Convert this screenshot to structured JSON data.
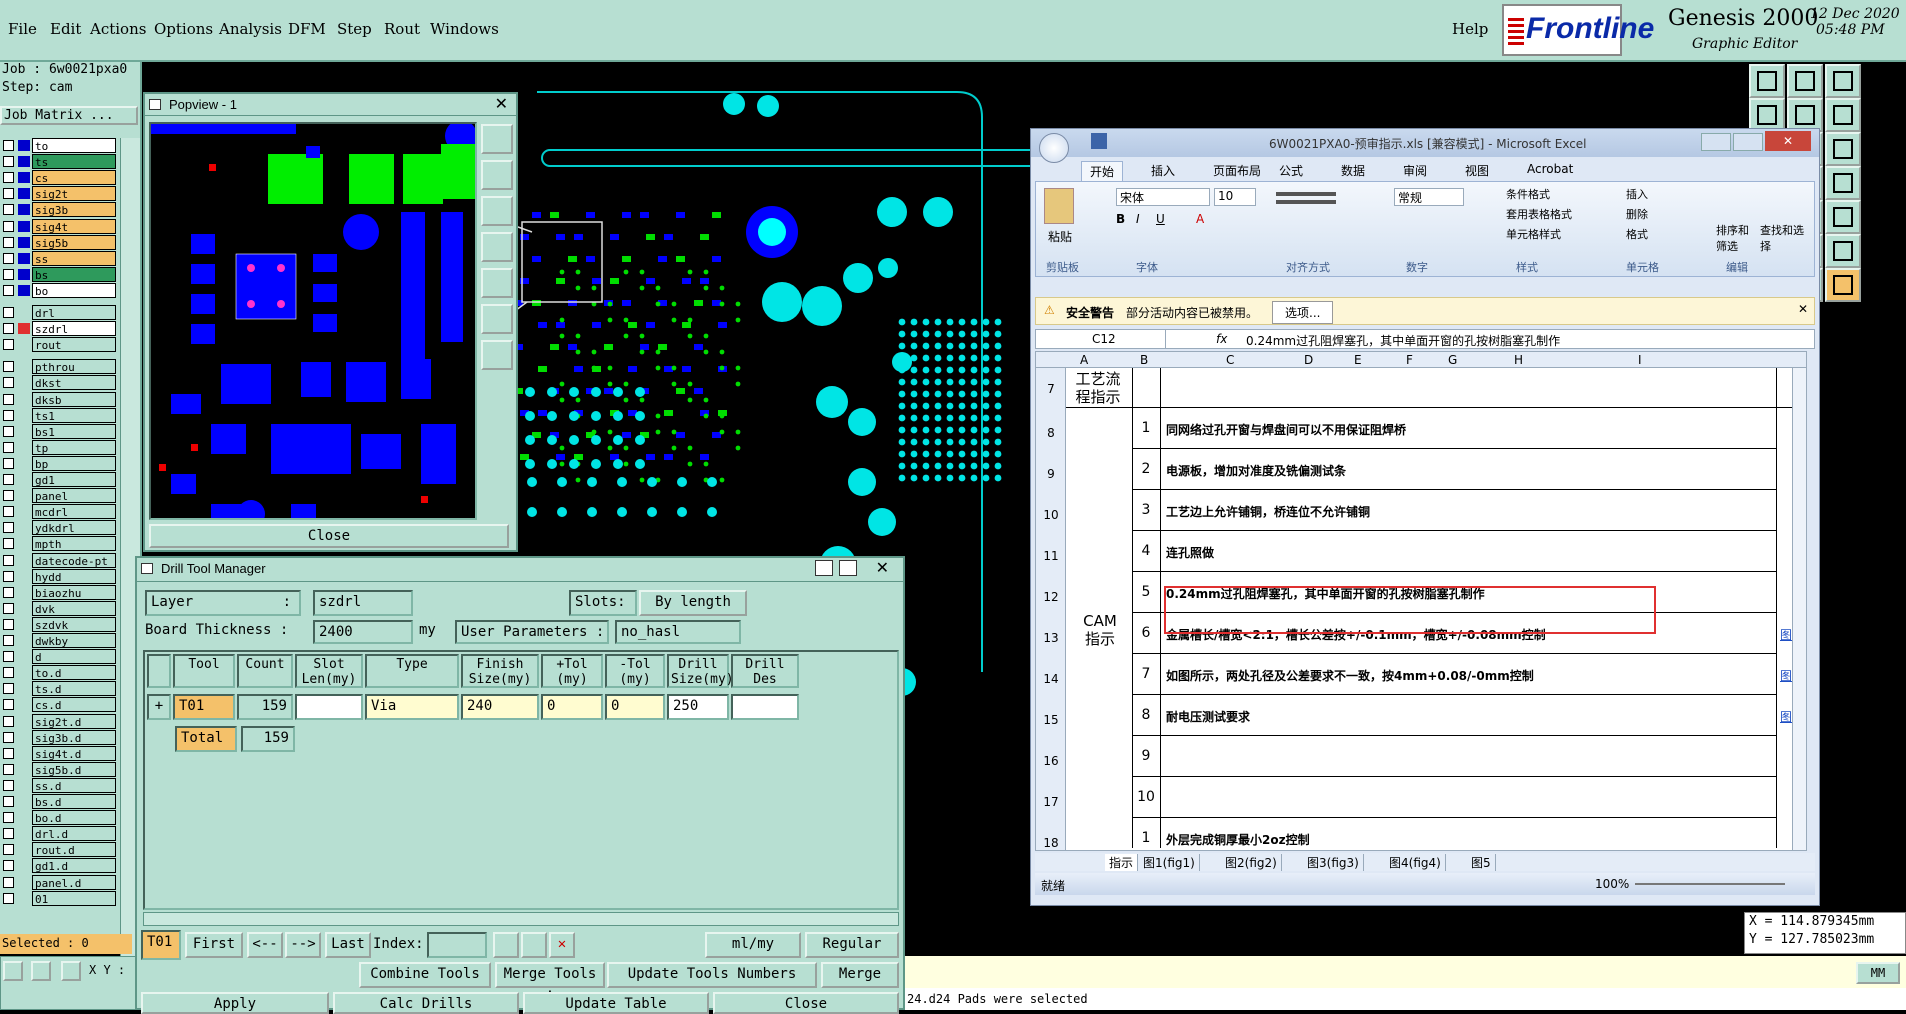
{
  "menu": {
    "items": [
      "File",
      "Edit",
      "Actions",
      "Options",
      "Analysis",
      "DFM",
      "Step",
      "Rout",
      "Windows"
    ],
    "help": "Help"
  },
  "brand": {
    "logo": "Frontline",
    "product": "Genesis 2000",
    "subtitle": "Graphic Editor",
    "date": "12 Dec 2020",
    "time": "05:48 PM"
  },
  "job": {
    "job_line": "Job : 6w0021pxa0",
    "step_line": "Step: cam",
    "matrix_label": "Job Matrix ...",
    "selected": "Selected : 0",
    "xy_label": "X Y :"
  },
  "layers": [
    {
      "name": "to",
      "color": "#ffffff"
    },
    {
      "name": "ts",
      "color": "#2e9a5c"
    },
    {
      "name": "cs",
      "color": "#f4c16a"
    },
    {
      "name": "sig2t",
      "color": "#f4c16a"
    },
    {
      "name": "sig3b",
      "color": "#f4c16a"
    },
    {
      "name": "sig4t",
      "color": "#f4c16a"
    },
    {
      "name": "sig5b",
      "color": "#f4c16a"
    },
    {
      "name": "ss",
      "color": "#f4c16a"
    },
    {
      "name": "bs",
      "color": "#2e9a5c"
    },
    {
      "name": "bo",
      "color": "#ffffff"
    },
    {
      "name": "drl",
      "color": "#b7dfd2"
    },
    {
      "name": "szdrl",
      "color": "#ffffff"
    },
    {
      "name": "rout",
      "color": "#b7dfd2"
    },
    {
      "name": "pthrou",
      "color": "#b7dfd2"
    },
    {
      "name": "dkst",
      "color": "#b7dfd2"
    },
    {
      "name": "dksb",
      "color": "#b7dfd2"
    },
    {
      "name": "ts1",
      "color": "#b7dfd2"
    },
    {
      "name": "bs1",
      "color": "#b7dfd2"
    },
    {
      "name": "tp",
      "color": "#b7dfd2"
    },
    {
      "name": "bp",
      "color": "#b7dfd2"
    },
    {
      "name": "gd1",
      "color": "#b7dfd2"
    },
    {
      "name": "panel",
      "color": "#b7dfd2"
    },
    {
      "name": "mcdrl",
      "color": "#b7dfd2"
    },
    {
      "name": "ydkdrl",
      "color": "#b7dfd2"
    },
    {
      "name": "mpth",
      "color": "#b7dfd2"
    },
    {
      "name": "datecode-pt",
      "color": "#b7dfd2"
    },
    {
      "name": "hydd",
      "color": "#b7dfd2"
    },
    {
      "name": "biaozhu",
      "color": "#b7dfd2"
    },
    {
      "name": "dvk",
      "color": "#b7dfd2"
    },
    {
      "name": "szdvk",
      "color": "#b7dfd2"
    },
    {
      "name": "dwkby",
      "color": "#b7dfd2"
    },
    {
      "name": "d",
      "color": "#b7dfd2"
    },
    {
      "name": "to.d",
      "color": "#b7dfd2"
    },
    {
      "name": "ts.d",
      "color": "#b7dfd2"
    },
    {
      "name": "cs.d",
      "color": "#b7dfd2"
    },
    {
      "name": "sig2t.d",
      "color": "#b7dfd2"
    },
    {
      "name": "sig3b.d",
      "color": "#b7dfd2"
    },
    {
      "name": "sig4t.d",
      "color": "#b7dfd2"
    },
    {
      "name": "sig5b.d",
      "color": "#b7dfd2"
    },
    {
      "name": "ss.d",
      "color": "#b7dfd2"
    },
    {
      "name": "bs.d",
      "color": "#b7dfd2"
    },
    {
      "name": "bo.d",
      "color": "#b7dfd2"
    },
    {
      "name": "drl.d",
      "color": "#b7dfd2"
    },
    {
      "name": "rout.d",
      "color": "#b7dfd2"
    },
    {
      "name": "gd1.d",
      "color": "#b7dfd2"
    },
    {
      "name": "panel.d",
      "color": "#b7dfd2"
    },
    {
      "name": "01",
      "color": "#b7dfd2"
    }
  ],
  "popview": {
    "title": "Popview - 1",
    "close": "Close"
  },
  "drill": {
    "title": "Drill Tool Manager",
    "layer_label": "Layer",
    "layer_value": "szdrl",
    "slots_label": "Slots:",
    "slots_value": "By length",
    "thickness_label": "Board Thickness :",
    "thickness_value": "2400",
    "thickness_unit": "my",
    "user_params_label": "User Parameters :",
    "user_params_value": "no_hasl",
    "headers": [
      "Tool",
      "Count",
      "Slot Len(my)",
      "Type",
      "Finish Size(my)",
      "+Tol (my)",
      "-Tol (my)",
      "Drill Size(my)",
      "Drill Des"
    ],
    "row": {
      "tool": "T01",
      "count": "159",
      "slot_len": "",
      "type": "Via",
      "finish": "240",
      "ptol": "0",
      "ntol": "0",
      "drill": "250",
      "des": ""
    },
    "total_label": "Total",
    "total_count": "159",
    "current_tool": "T01",
    "first": "First",
    "prev": "<--",
    "next": "-->",
    "last": "Last",
    "index_label": "Index:",
    "units": "ml/my",
    "mode": "Regular",
    "combine": "Combine Tools",
    "merge_tools": "Merge Tools :",
    "update_numbers": "Update Tools Numbers",
    "merge": "Merge",
    "apply": "Apply",
    "calc": "Calc Drills",
    "update_table": "Update Table",
    "close": "Close"
  },
  "excel": {
    "title": "6W0021PXA0-预审指示.xls [兼容模式] - Microsoft Excel",
    "tabs": [
      "开始",
      "插入",
      "页面布局",
      "公式",
      "数据",
      "审阅",
      "视图",
      "Acrobat"
    ],
    "font_name": "宋体",
    "font_size": "10",
    "number_format": "常规",
    "groups": [
      "剪贴板",
      "字体",
      "对齐方式",
      "数字",
      "样式",
      "单元格",
      "编辑"
    ],
    "styles_items": [
      "条件格式",
      "套用表格格式",
      "单元格样式"
    ],
    "cells_items": [
      "插入",
      "删除",
      "格式"
    ],
    "edit_items": [
      "排序和筛选",
      "查找和选择"
    ],
    "paste_label": "粘贴",
    "security_title": "安全警告",
    "security_msg": "部分活动内容已被禁用。",
    "options_button": "选项...",
    "name_box": "C12",
    "fx": "fx",
    "formula": "0.24mm过孔阻焊塞孔，其中单面开窗的孔按树脂塞孔制作",
    "columns": [
      "A",
      "B",
      "C",
      "D",
      "E",
      "F",
      "G",
      "H",
      "I"
    ],
    "row7_header": "工艺流程指示",
    "cam_label": "CAM指示",
    "rows": [
      {
        "row": "8",
        "num": "1",
        "text": "同网络过孔开窗与焊盘间可以不用保证阻焊桥",
        "link": ""
      },
      {
        "row": "9",
        "num": "2",
        "text": "电源板，增加对准度及铣偏测试条",
        "link": ""
      },
      {
        "row": "10",
        "num": "3",
        "text": "工艺边上允许铺铜，桥连位不允许铺铜",
        "link": ""
      },
      {
        "row": "11",
        "num": "4",
        "text": "连孔照做",
        "link": ""
      },
      {
        "row": "12",
        "num": "5",
        "text": "0.24mm过孔阻焊塞孔，其中单面开窗的孔按树脂塞孔制作",
        "link": ""
      },
      {
        "row": "13",
        "num": "6",
        "text": "金属槽长/槽宽<2:1，槽长公差按+/-0.1mm，槽宽+/-0.08mm控制",
        "link": "图1"
      },
      {
        "row": "14",
        "num": "7",
        "text": "如图所示，两处孔径及公差要求不一致，按4mm+0.08/-0mm控制",
        "link": "图2"
      },
      {
        "row": "15",
        "num": "8",
        "text": "耐电压测试要求",
        "link": "图3"
      },
      {
        "row": "16",
        "num": "9",
        "text": "",
        "link": ""
      },
      {
        "row": "17",
        "num": "10",
        "text": "",
        "link": ""
      },
      {
        "row": "18",
        "num": "1",
        "text": "外层完成铜厚最小2oz控制",
        "link": ""
      }
    ],
    "sheet_tabs": [
      "指示",
      "图1(fig1)",
      "图2(fig2)",
      "图3(fig3)",
      "图4(fig4)",
      "图5"
    ],
    "status_ready": "就绪",
    "zoom": "100%"
  },
  "coords": {
    "x": "X = 114.879345mm",
    "y": "Y = 127.785023mm"
  },
  "units_badge": "MM",
  "status_message": "24.d24 Pads were selected"
}
